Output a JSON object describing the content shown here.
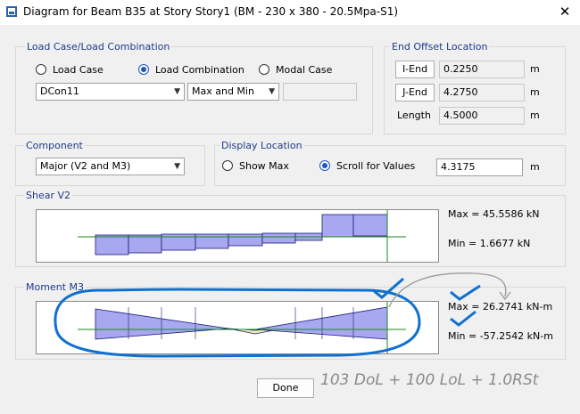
{
  "window": {
    "title": "Diagram for Beam B35 at Story Story1 (BM - 230 x 380 - 20.5Mpa-S1)",
    "close_label": "✕"
  },
  "load_case": {
    "group_label": "Load Case/Load Combination",
    "options": [
      {
        "label": "Load Case",
        "selected": false
      },
      {
        "label": "Load Combination",
        "selected": true
      },
      {
        "label": "Modal Case",
        "selected": false
      }
    ],
    "combo_value": "DCon11",
    "type_value": "Max and Min",
    "extra_value": ""
  },
  "end_offset": {
    "group_label": "End Offset Location",
    "i_end_label": "I-End",
    "i_end_value": "0.2250",
    "j_end_label": "J-End",
    "j_end_value": "4.2750",
    "length_label": "Length",
    "length_value": "4.5000",
    "unit": "m"
  },
  "component": {
    "group_label": "Component",
    "value": "Major (V2 and M3)"
  },
  "display_location": {
    "group_label": "Display Location",
    "options": [
      {
        "label": "Show Max",
        "selected": false
      },
      {
        "label": "Scroll for Values",
        "selected": true
      }
    ],
    "value": "4.3175",
    "unit": "m"
  },
  "shear": {
    "group_label": "Shear V2",
    "max_text": "Max = 45.5586 kN",
    "min_text": "Min = 1.6677 kN"
  },
  "moment": {
    "group_label": "Moment M3",
    "max_text": "Max = 26.2741 kN-m",
    "min_text": "Min = -57.2542 kN-m"
  },
  "done_label": "Done",
  "handwriting": "103 DoL + 100 LoL + 1.0RSt",
  "colors": {
    "fill": "#a8a8f0",
    "stroke": "#1a1a7a",
    "axis": "#1a8a1a",
    "positive_fill": "#f0f0b0",
    "annotation": "#1070d0"
  }
}
